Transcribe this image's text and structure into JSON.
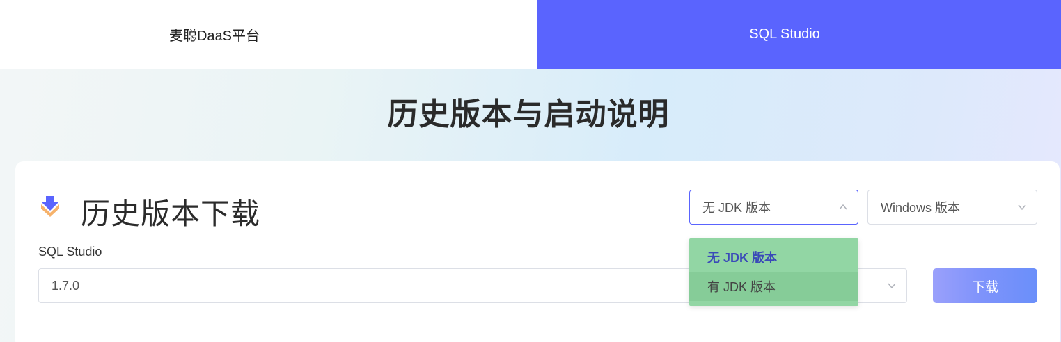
{
  "nav": {
    "tabs": [
      {
        "label": "麦聪DaaS平台",
        "active": false
      },
      {
        "label": "SQL Studio",
        "active": true
      }
    ]
  },
  "page": {
    "title": "历史版本与启动说明"
  },
  "download_card": {
    "title": "历史版本下载",
    "jdk_select": {
      "value": "无 JDK 版本",
      "open": true
    },
    "os_select": {
      "value": "Windows 版本"
    },
    "product_label": "SQL Studio",
    "version_select": {
      "value": "1.7.0"
    },
    "download_label": "下载"
  },
  "jdk_dropdown": {
    "options": [
      {
        "label": "无 JDK 版本",
        "selected": true
      },
      {
        "label": "有 JDK 版本",
        "selected": false
      }
    ]
  },
  "colors": {
    "accent": "#5a64fe",
    "dropdown_bg": "#92d6a4",
    "selected_text": "#3a4ab8"
  }
}
